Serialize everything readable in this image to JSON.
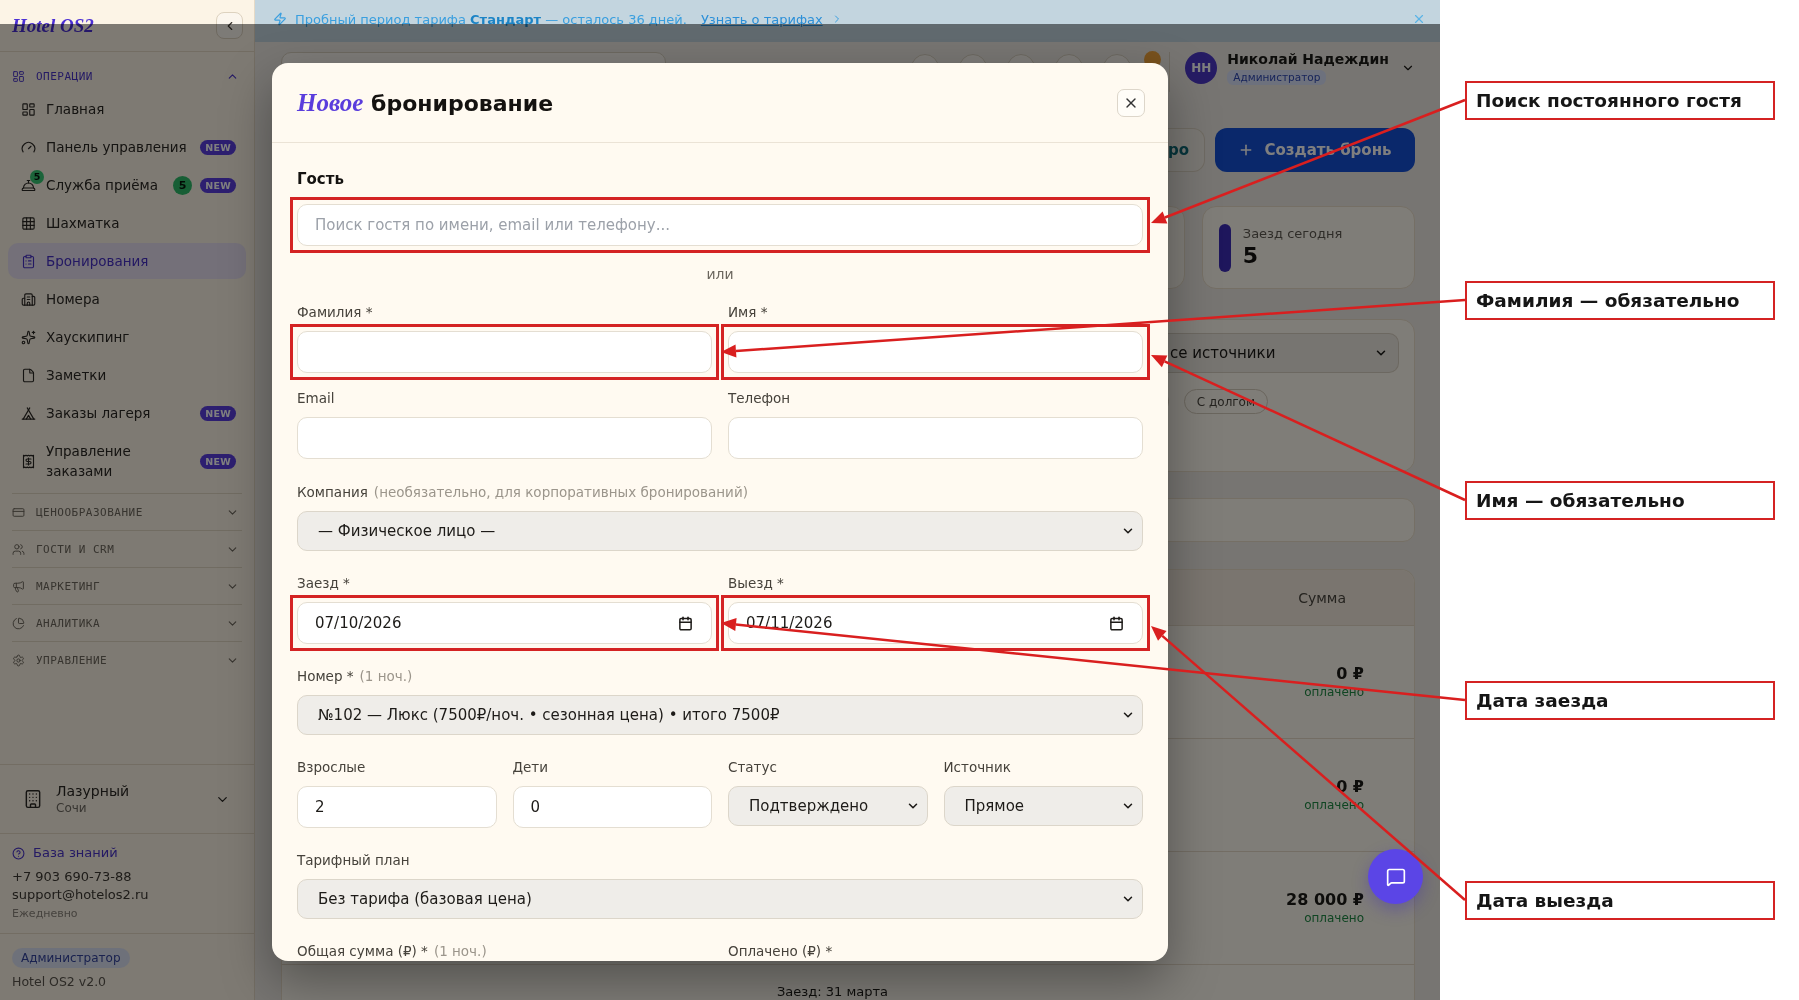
{
  "trial_banner": {
    "text": "Пробный период тарифа **Стандарт** — осталось 36 дней.",
    "link": "Узнать о тарифах"
  },
  "sidebar": {
    "logo": "Hotel OS2",
    "sections": [
      {
        "title": "ОПЕРАЦИИ",
        "expanded": true,
        "items": [
          {
            "label": "Главная",
            "selected": false
          },
          {
            "label": "Панель управления",
            "selected": false,
            "badge": "NEW"
          },
          {
            "label": "Служба приёма",
            "selected": false,
            "icon_count": "5",
            "count": "5",
            "badge": "NEW"
          },
          {
            "label": "Шахматка",
            "selected": false
          },
          {
            "label": "Бронирования",
            "selected": true
          },
          {
            "label": "Номера",
            "selected": false
          },
          {
            "label": "Хаускипинг",
            "selected": false
          },
          {
            "label": "Заметки",
            "selected": false
          },
          {
            "label": "Заказы лагеря",
            "selected": false,
            "badge": "NEW"
          },
          {
            "label": "Управление заказами",
            "selected": false,
            "badge": "NEW"
          }
        ]
      },
      {
        "title": "ЦЕНООБРАЗОВАНИЕ",
        "expanded": false
      },
      {
        "title": "ГОСТИ И CRM",
        "expanded": false
      },
      {
        "title": "МАРКЕТИНГ",
        "expanded": false
      },
      {
        "title": "АНАЛИТИКА",
        "expanded": false
      },
      {
        "title": "УПРАВЛЕНИЕ",
        "expanded": false
      }
    ],
    "property": {
      "name": "Лазурный",
      "city": "Сочи"
    },
    "support": {
      "link": "База знаний",
      "phone": "+7 903 690-73-88",
      "email": "support@hotelos2.ru",
      "hours": "Ежедневно"
    },
    "role": "Администратор",
    "version": "Hotel OS2 v2.0"
  },
  "header": {
    "user": {
      "initials": "НН",
      "name": "Николай Надеждин",
      "role": "Администратор"
    }
  },
  "page": {
    "toolbar": {
      "partial_button": "ро",
      "create_button": "Создать бронь"
    },
    "stats": [
      {
        "label": "Заезд сегодня",
        "value": "5"
      }
    ],
    "filters": {
      "source": "се источники",
      "chips": [
        "С долгом"
      ]
    },
    "table": {
      "sum_heading": "Сумма",
      "rows": [
        {
          "sum": "0 ₽",
          "sum_note": "оплачено"
        },
        {
          "sum": "0 ₽",
          "sum_note": "оплачено"
        },
        {
          "sum": "28 000 ₽",
          "sum_note": "оплачено"
        },
        {
          "column_2": "Заезд: 31 марта"
        }
      ]
    }
  },
  "modal": {
    "title": "*Новое* бронирование",
    "guest": {
      "title": "Гость",
      "search": {
        "placeholder": "Поиск гостя по имени, email или телефону...",
        "highlighted": true
      },
      "separator": "или",
      "rows": [
        {
          "fields": [
            {
              "label": "Фамилия *",
              "kind": "text",
              "highlighted": true
            },
            {
              "label": "Имя *",
              "kind": "text",
              "highlighted": true
            }
          ]
        },
        {
          "fields": [
            {
              "label": "Email",
              "kind": "text",
              "highlighted": false
            },
            {
              "label": "Телефон",
              "kind": "text",
              "highlighted": false
            }
          ]
        }
      ]
    },
    "rows": [
      {
        "fields": [
          {
            "label": "Компания",
            "hint": "(необязательно, для корпоративных бронирований)",
            "kind": "select",
            "value": "— Физическое лицо —",
            "highlighted": false
          }
        ]
      },
      {
        "fields": [
          {
            "label": "Заезд *",
            "kind": "date",
            "value": "07/10/2026",
            "highlighted": true
          },
          {
            "label": "Выезд *",
            "kind": "date",
            "value": "07/11/2026",
            "highlighted": true
          }
        ]
      },
      {
        "fields": [
          {
            "label": "Номер *",
            "hint": "(1 ноч.)",
            "kind": "select",
            "value": "№102 — Люкс (7500₽/ноч. • сезонная цена) • итого 7500₽",
            "highlighted": false
          }
        ]
      },
      {
        "fields": [
          {
            "label": "Взрослые",
            "kind": "text",
            "value": "2",
            "highlighted": false
          },
          {
            "label": "Дети",
            "kind": "text",
            "value": "0",
            "highlighted": false
          },
          {
            "label": "Статус",
            "kind": "select",
            "value": "Подтверждено",
            "highlighted": false
          },
          {
            "label": "Источник",
            "kind": "select",
            "value": "Прямое",
            "highlighted": false
          }
        ]
      },
      {
        "fields": [
          {
            "label": "Тарифный план",
            "kind": "select",
            "value": "Без тарифа (базовая цена)",
            "highlighted": false
          }
        ]
      },
      {
        "fields": [
          {
            "label": "Общая сумма (₽) *",
            "hint": "(1 ноч.)"
          },
          {
            "label": "Оплачено (₽) *"
          }
        ]
      }
    ]
  },
  "annotations": [
    {
      "text": "Поиск постоянного гостя"
    },
    {
      "text": "Фамилия — обязательно"
    },
    {
      "text": "Имя — обязательно"
    },
    {
      "text": "Дата заезда"
    },
    {
      "text": "Дата выезда"
    }
  ]
}
